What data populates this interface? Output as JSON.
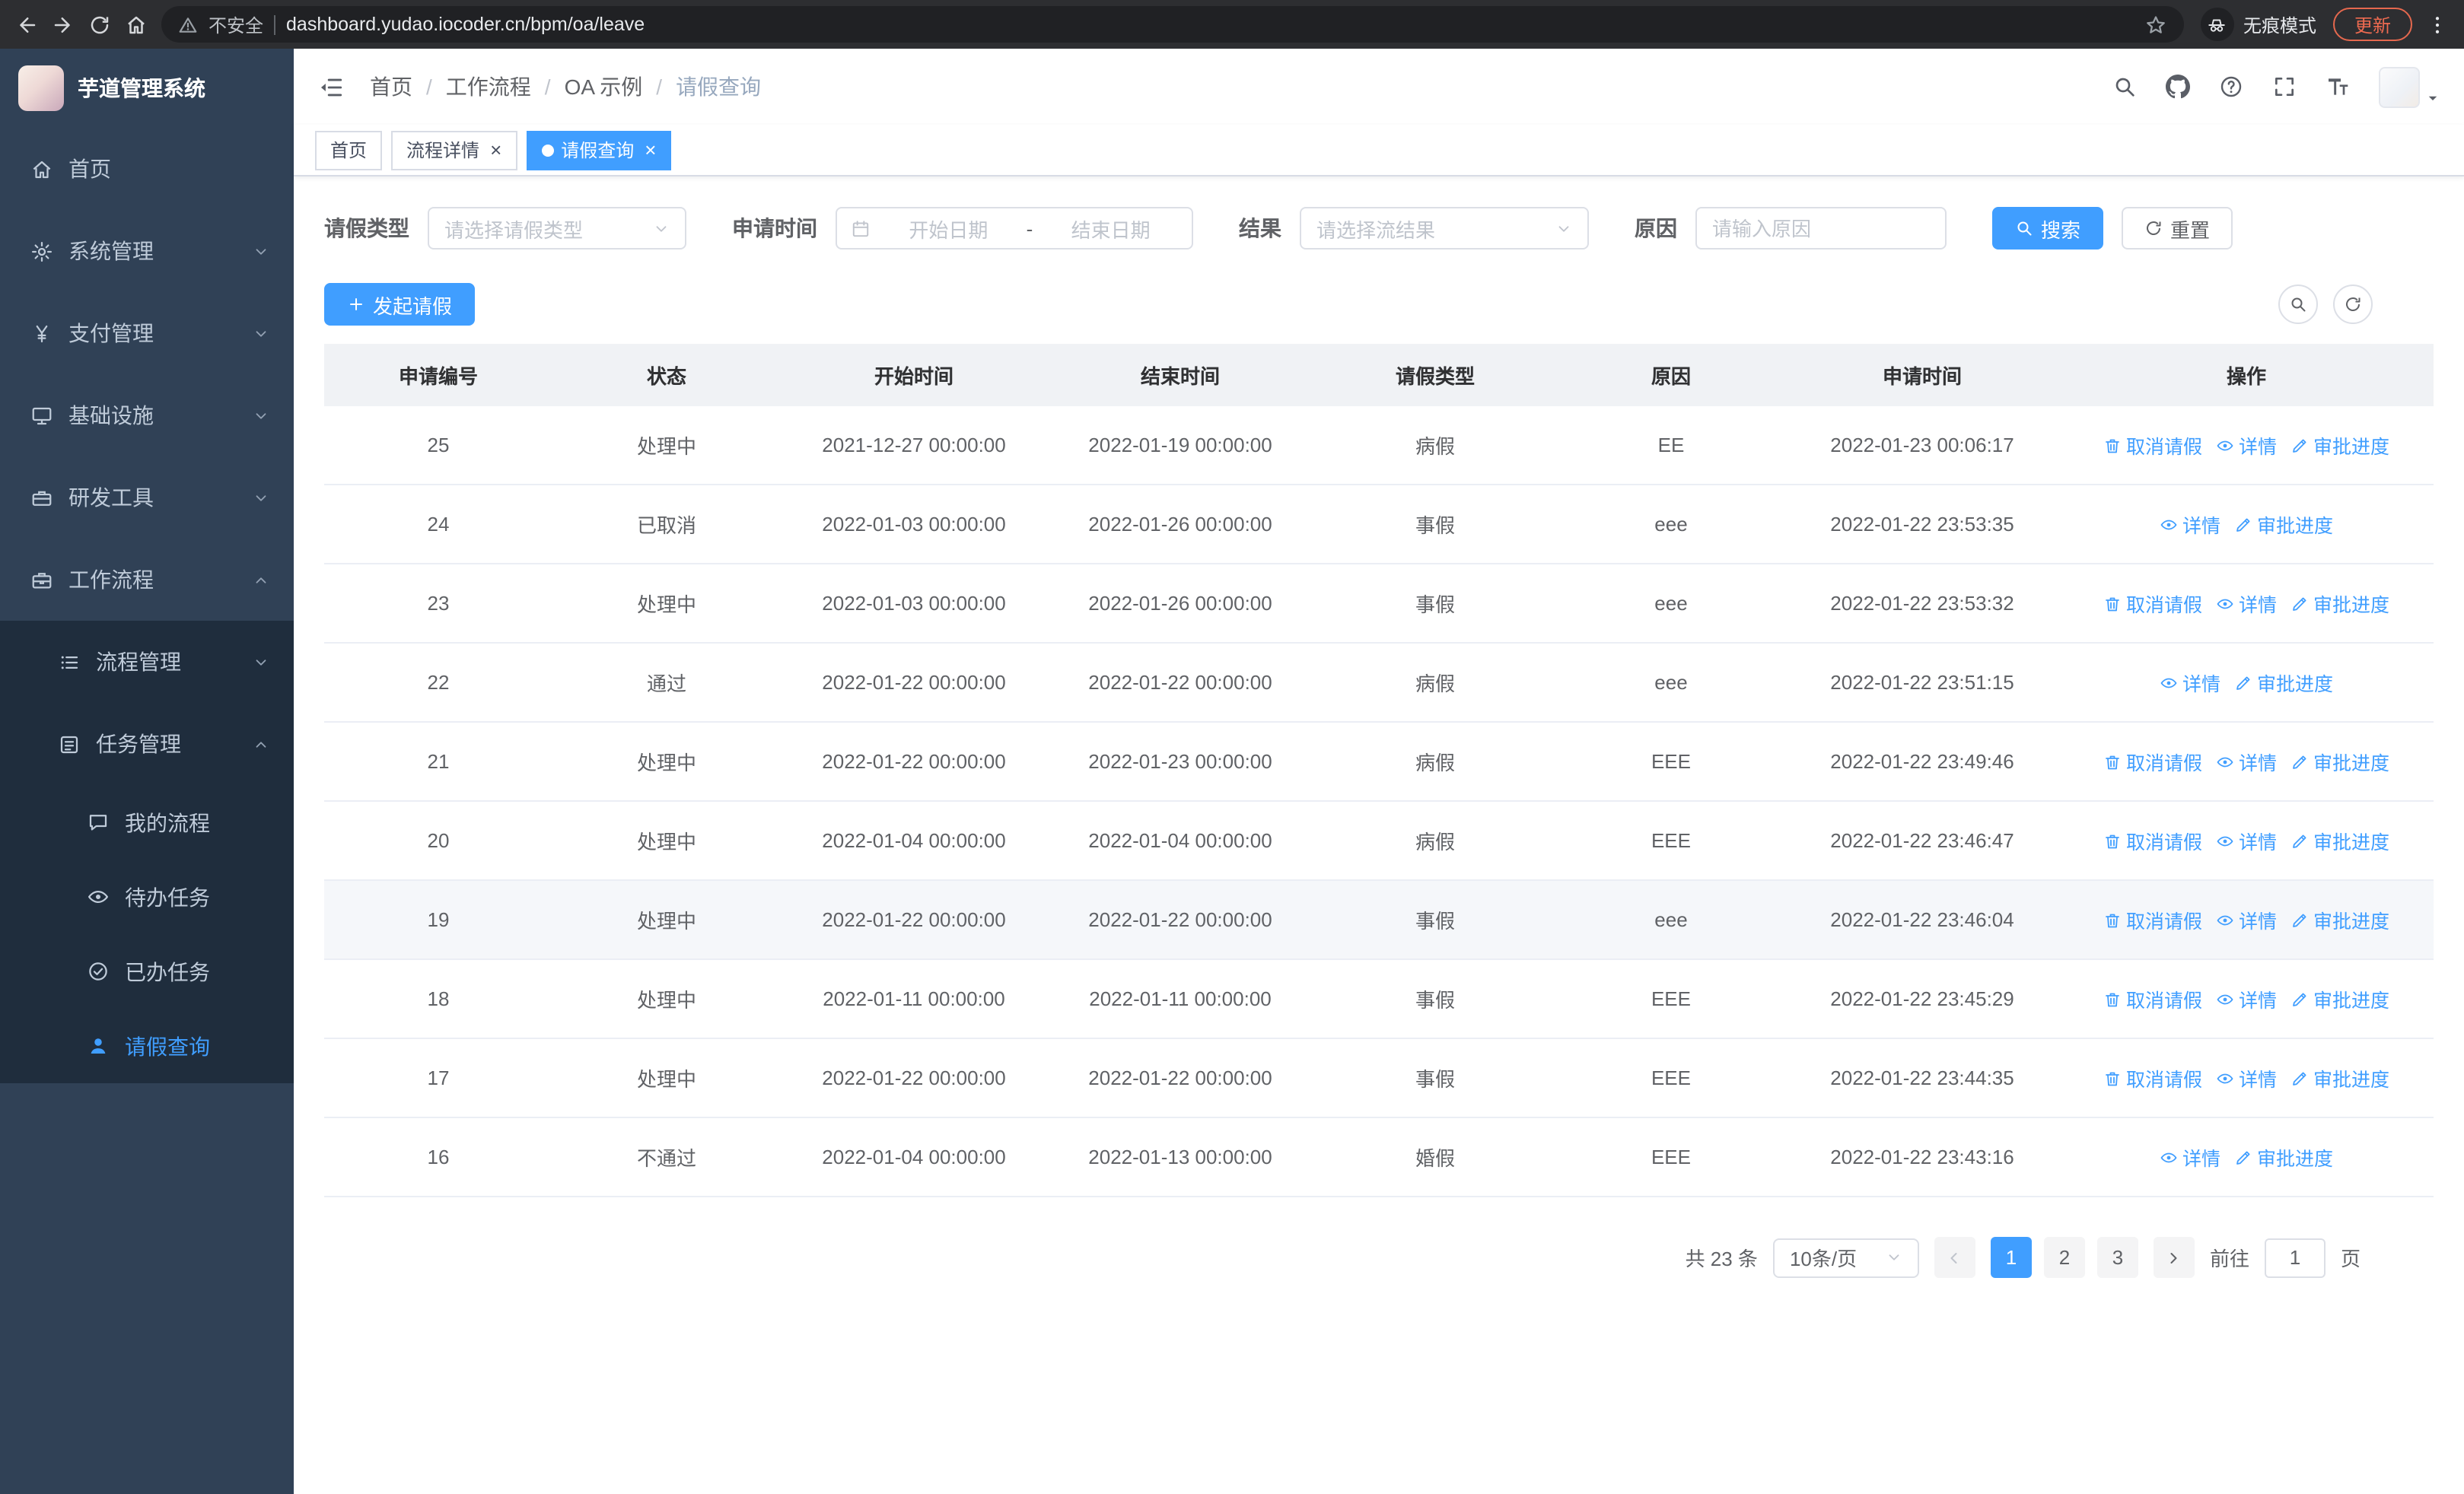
{
  "browser": {
    "security_label": "不安全",
    "url": "dashboard.yudao.iocoder.cn/bpm/oa/leave",
    "incognito_label": "无痕模式",
    "update_label": "更新"
  },
  "sidebar": {
    "logo_title": "芋道管理系统",
    "items": [
      {
        "key": "home",
        "label": "首页",
        "icon": "home",
        "level": 0
      },
      {
        "key": "system",
        "label": "系统管理",
        "icon": "gear",
        "level": 0,
        "chevron": "down"
      },
      {
        "key": "payment",
        "label": "支付管理",
        "icon": "yen",
        "level": 0,
        "chevron": "down"
      },
      {
        "key": "infra",
        "label": "基础设施",
        "icon": "infra",
        "level": 0,
        "chevron": "down"
      },
      {
        "key": "devtools",
        "label": "研发工具",
        "icon": "tools",
        "level": 0,
        "chevron": "down"
      },
      {
        "key": "workflow",
        "label": "工作流程",
        "icon": "briefcase",
        "level": 0,
        "chevron": "up",
        "expanded": true
      },
      {
        "key": "process-mgmt",
        "label": "流程管理",
        "icon": "list",
        "level": 1,
        "chevron": "down"
      },
      {
        "key": "task-mgmt",
        "label": "任务管理",
        "icon": "task",
        "level": 1,
        "chevron": "up",
        "expanded": true
      },
      {
        "key": "my-process",
        "label": "我的流程",
        "icon": "chat",
        "level": 2
      },
      {
        "key": "todo-task",
        "label": "待办任务",
        "icon": "eye",
        "level": 2
      },
      {
        "key": "done-task",
        "label": "已办任务",
        "icon": "done",
        "level": 2
      },
      {
        "key": "leave-query",
        "label": "请假查询",
        "icon": "user",
        "level": 2,
        "active": true
      }
    ]
  },
  "header": {
    "breadcrumb": [
      "首页",
      "工作流程",
      "OA 示例",
      "请假查询"
    ]
  },
  "tabs": [
    {
      "key": "home",
      "label": "首页",
      "closable": false,
      "active": false
    },
    {
      "key": "process-detail",
      "label": "流程详情",
      "closable": true,
      "active": false
    },
    {
      "key": "leave-query",
      "label": "请假查询",
      "closable": true,
      "active": true
    }
  ],
  "filters": {
    "leave_type_label": "请假类型",
    "leave_type_placeholder": "请选择请假类型",
    "apply_time_label": "申请时间",
    "start_date_placeholder": "开始日期",
    "range_separator": "-",
    "end_date_placeholder": "结束日期",
    "result_label": "结果",
    "result_placeholder": "请选择流结果",
    "reason_label": "原因",
    "reason_placeholder": "请输入原因",
    "search_label": "搜索",
    "reset_label": "重置"
  },
  "toolbar": {
    "create_label": "发起请假"
  },
  "table": {
    "columns": [
      "申请编号",
      "状态",
      "开始时间",
      "结束时间",
      "请假类型",
      "原因",
      "申请时间",
      "操作"
    ],
    "rows": [
      {
        "id": "25",
        "status": "处理中",
        "start": "2021-12-27 00:00:00",
        "end": "2022-01-19 00:00:00",
        "type": "病假",
        "reason": "EE",
        "applied": "2022-01-23 00:06:17",
        "cancel": true,
        "highlight": false
      },
      {
        "id": "24",
        "status": "已取消",
        "start": "2022-01-03 00:00:00",
        "end": "2022-01-26 00:00:00",
        "type": "事假",
        "reason": "eee",
        "applied": "2022-01-22 23:53:35",
        "cancel": false,
        "highlight": false
      },
      {
        "id": "23",
        "status": "处理中",
        "start": "2022-01-03 00:00:00",
        "end": "2022-01-26 00:00:00",
        "type": "事假",
        "reason": "eee",
        "applied": "2022-01-22 23:53:32",
        "cancel": true,
        "highlight": false
      },
      {
        "id": "22",
        "status": "通过",
        "start": "2022-01-22 00:00:00",
        "end": "2022-01-22 00:00:00",
        "type": "病假",
        "reason": "eee",
        "applied": "2022-01-22 23:51:15",
        "cancel": false,
        "highlight": false
      },
      {
        "id": "21",
        "status": "处理中",
        "start": "2022-01-22 00:00:00",
        "end": "2022-01-23 00:00:00",
        "type": "病假",
        "reason": "EEE",
        "applied": "2022-01-22 23:49:46",
        "cancel": true,
        "highlight": false
      },
      {
        "id": "20",
        "status": "处理中",
        "start": "2022-01-04 00:00:00",
        "end": "2022-01-04 00:00:00",
        "type": "病假",
        "reason": "EEE",
        "applied": "2022-01-22 23:46:47",
        "cancel": true,
        "highlight": false
      },
      {
        "id": "19",
        "status": "处理中",
        "start": "2022-01-22 00:00:00",
        "end": "2022-01-22 00:00:00",
        "type": "事假",
        "reason": "eee",
        "applied": "2022-01-22 23:46:04",
        "cancel": true,
        "highlight": true
      },
      {
        "id": "18",
        "status": "处理中",
        "start": "2022-01-11 00:00:00",
        "end": "2022-01-11 00:00:00",
        "type": "事假",
        "reason": "EEE",
        "applied": "2022-01-22 23:45:29",
        "cancel": true,
        "highlight": false
      },
      {
        "id": "17",
        "status": "处理中",
        "start": "2022-01-22 00:00:00",
        "end": "2022-01-22 00:00:00",
        "type": "事假",
        "reason": "EEE",
        "applied": "2022-01-22 23:44:35",
        "cancel": true,
        "highlight": false
      },
      {
        "id": "16",
        "status": "不通过",
        "start": "2022-01-04 00:00:00",
        "end": "2022-01-13 00:00:00",
        "type": "婚假",
        "reason": "EEE",
        "applied": "2022-01-22 23:43:16",
        "cancel": false,
        "highlight": false
      }
    ]
  },
  "actions": {
    "cancel_label": "取消请假",
    "detail_label": "详情",
    "progress_label": "审批进度"
  },
  "pagination": {
    "total": "共 23 条",
    "page_size": "10条/页",
    "pages": [
      "1",
      "2",
      "3"
    ],
    "active_page": "1",
    "goto_label": "前往",
    "goto_value": "1",
    "page_label": "页"
  },
  "colors": {
    "accent": "#409eff",
    "sidebar_bg": "#304156",
    "submenu_bg": "#1f2d3d",
    "update_pill": "#ed6a50"
  }
}
